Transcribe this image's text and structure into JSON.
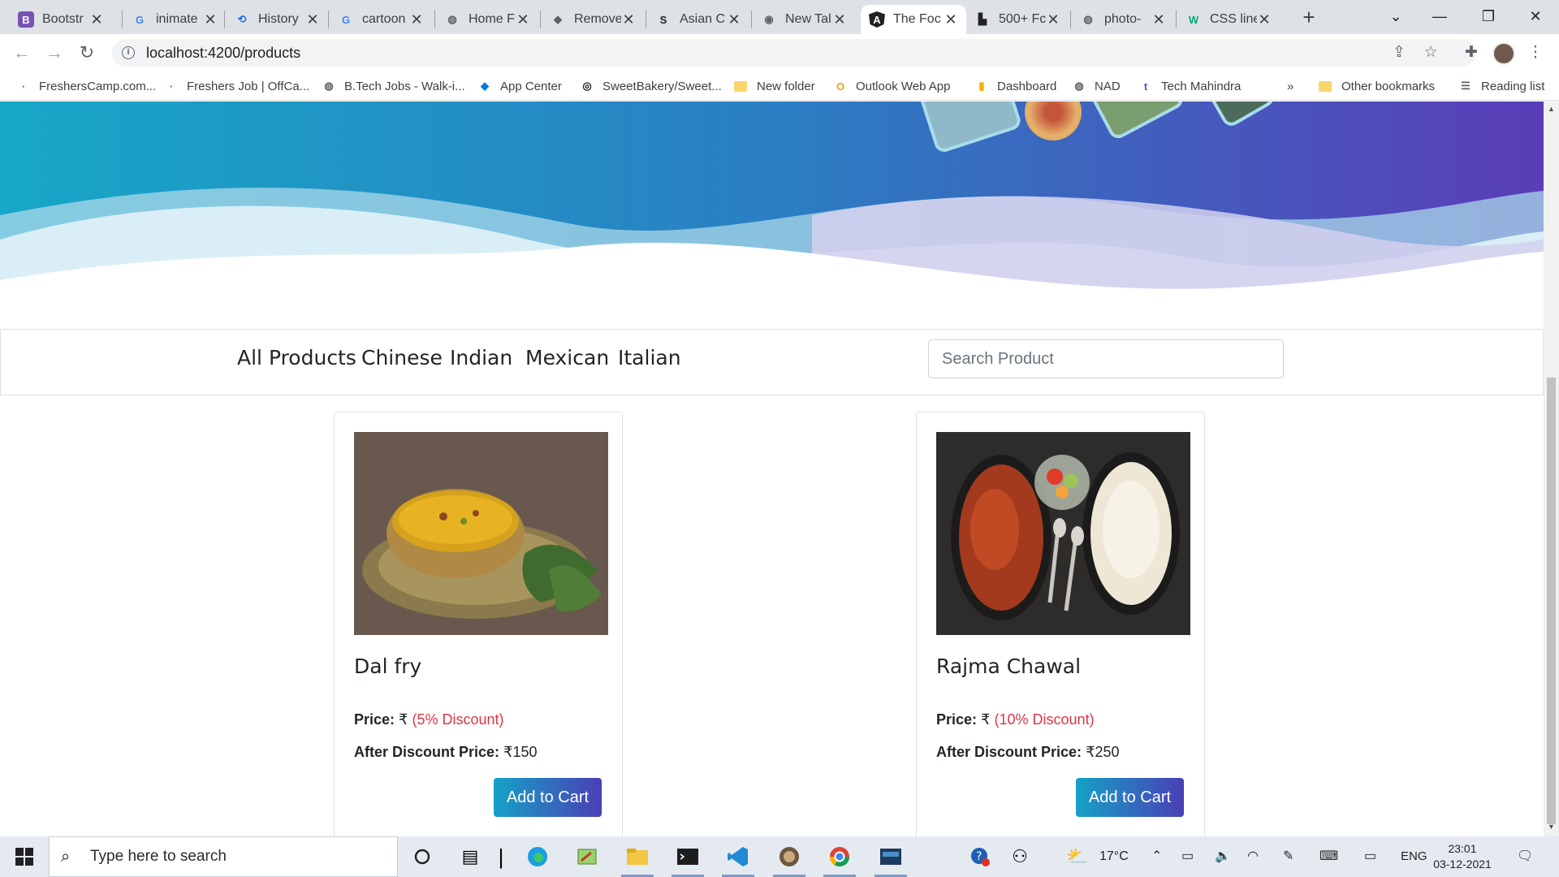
{
  "browser": {
    "tabs": [
      {
        "title": "Bootstr",
        "icon": "bootstrap-icon",
        "color": "#7952b3"
      },
      {
        "title": "inimate",
        "icon": "google-icon",
        "color": "#4285f4"
      },
      {
        "title": "History",
        "icon": "history-icon",
        "color": "#1a73e8"
      },
      {
        "title": "cartoon",
        "icon": "google-icon",
        "color": "#4285f4"
      },
      {
        "title": "Home F",
        "icon": "globe-icon",
        "color": "#5f6368"
      },
      {
        "title": "Remove",
        "icon": "remove-bg-icon",
        "color": "#5f6368"
      },
      {
        "title": "Asian C",
        "icon": "shutterstock-icon",
        "color": "#202124"
      },
      {
        "title": "New Tal",
        "icon": "chrome-icon",
        "color": "#5f6368"
      },
      {
        "title": "The Foc",
        "icon": "angular-icon",
        "color": "#202124"
      },
      {
        "title": "500+ Fc",
        "icon": "unsplash-icon",
        "color": "#202124"
      },
      {
        "title": "photo-",
        "icon": "globe-icon",
        "color": "#5f6368"
      },
      {
        "title": "CSS line",
        "icon": "w3schools-icon",
        "color": "#04aa6d"
      }
    ],
    "active_tab": 8,
    "new_tab_label": "+",
    "url": "localhost:4200/products",
    "bookmarks": [
      {
        "label": "FreshersCamp.com...",
        "icon": "site-icon"
      },
      {
        "label": "Freshers Job | OffCa...",
        "icon": "site-icon"
      },
      {
        "label": "B.Tech Jobs - Walk-i...",
        "icon": "globe-icon"
      },
      {
        "label": "App Center",
        "icon": "app-center-icon"
      },
      {
        "label": "SweetBakery/Sweet...",
        "icon": "github-icon"
      },
      {
        "label": "New folder",
        "icon": "folder-icon"
      },
      {
        "label": "Outlook Web App",
        "icon": "outlook-icon"
      },
      {
        "label": "Dashboard",
        "icon": "dashboard-icon"
      },
      {
        "label": "NAD",
        "icon": "globe-icon"
      },
      {
        "label": "Tech Mahindra",
        "icon": "tech-mahindra-icon"
      }
    ],
    "bookmarks_overflow": "»",
    "other_bookmarks": "Other bookmarks",
    "reading_list": "Reading list"
  },
  "page": {
    "categories": [
      "All Products",
      "Chinese",
      "Indian",
      "Mexican",
      "Italian"
    ],
    "search_placeholder": "Search Product",
    "products": [
      {
        "name": "Dal fry",
        "price_label": "Price:",
        "currency": "₹",
        "discount": "(5% Discount)",
        "after_label": "After Discount Price:",
        "after_price": "₹150",
        "button": "Add to Cart"
      },
      {
        "name": "Rajma Chawal",
        "price_label": "Price:",
        "currency": "₹",
        "discount": "(10% Discount)",
        "after_label": "After Discount Price:",
        "after_price": "₹250",
        "button": "Add to Cart"
      }
    ],
    "colors": {
      "hero_start": "#17a7c7",
      "hero_end": "#5a3db8",
      "discount": "#dc3545"
    }
  },
  "taskbar": {
    "search_placeholder": "Type here to search",
    "weather": "17°C",
    "language": "ENG",
    "time": "23:01",
    "date": "03-12-2021"
  }
}
